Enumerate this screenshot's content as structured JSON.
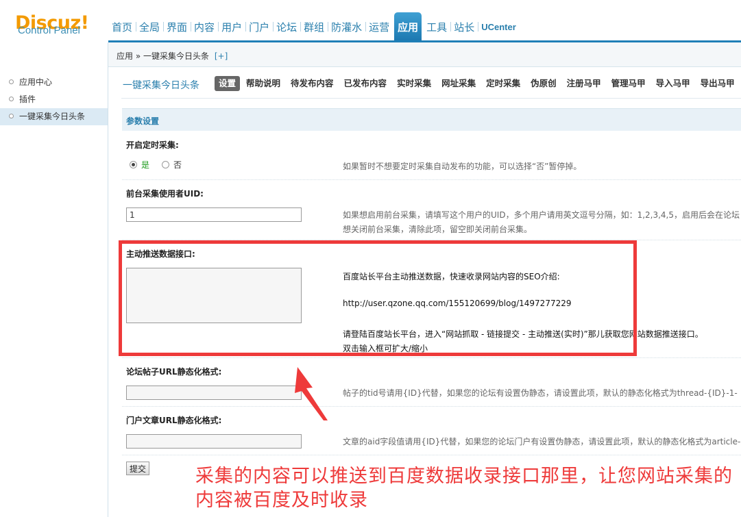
{
  "logo": {
    "brand": "Discuz!",
    "subtitle": "Control Panel"
  },
  "topnav": [
    {
      "label": "首页",
      "active": false
    },
    {
      "label": "全局",
      "active": false
    },
    {
      "label": "界面",
      "active": false
    },
    {
      "label": "内容",
      "active": false
    },
    {
      "label": "用户",
      "active": false
    },
    {
      "label": "门户",
      "active": false
    },
    {
      "label": "论坛",
      "active": false
    },
    {
      "label": "群组",
      "active": false
    },
    {
      "label": "防灌水",
      "active": false
    },
    {
      "label": "运营",
      "active": false
    },
    {
      "label": "应用",
      "active": true
    },
    {
      "label": "工具",
      "active": false
    },
    {
      "label": "站长",
      "active": false
    },
    {
      "label": "UCenter",
      "active": false
    }
  ],
  "sidebar": {
    "items": [
      {
        "label": "应用中心",
        "active": false
      },
      {
        "label": "插件",
        "active": false
      },
      {
        "label": "一键采集今日头条",
        "active": true
      }
    ]
  },
  "breadcrumb": {
    "root": "应用",
    "sep": "»",
    "current": "一键采集今日头条",
    "plus": "[+]"
  },
  "plugin": {
    "title": "一键采集今日头条",
    "tabs": [
      {
        "label": "设置",
        "active": true
      },
      {
        "label": "帮助说明",
        "active": false
      },
      {
        "label": "待发布内容",
        "active": false
      },
      {
        "label": "已发布内容",
        "active": false
      },
      {
        "label": "实时采集",
        "active": false
      },
      {
        "label": "网址采集",
        "active": false
      },
      {
        "label": "定时采集",
        "active": false
      },
      {
        "label": "伪原创",
        "active": false
      },
      {
        "label": "注册马甲",
        "active": false
      },
      {
        "label": "管理马甲",
        "active": false
      },
      {
        "label": "导入马甲",
        "active": false
      },
      {
        "label": "导出马甲",
        "active": false
      }
    ]
  },
  "section": {
    "title": "参数设置"
  },
  "form": {
    "timed": {
      "label": "开启定时采集:",
      "yes": "是",
      "no": "否",
      "selected": "是",
      "tip": "如果暂时不想要定时采集自动发布的功能，可以选择“否”暂停掉。"
    },
    "uid": {
      "label": "前台采集使用者UID:",
      "value": "1",
      "tip1": "如果想启用前台采集，请填写这个用户的UID，多个用户请用英文逗号分隔，如：1,2,3,4,5，启用后会在论坛",
      "tip2": "想关闭前台采集，清除此项，留空即关闭前台采集。"
    },
    "push": {
      "label": "主动推送数据接口:",
      "value": "",
      "line1": "百度站长平台主动推送数据，快速收录网站内容的SEO介绍:",
      "line2": "http://user.qzone.qq.com/155120699/blog/1497277229",
      "line3": "请登陆百度站长平台，进入“网站抓取 - 链接提交 - 主动推送(实时)”那儿获取您网站数据推送接口。",
      "line4": "双击输入框可扩大/缩小"
    },
    "forum_url": {
      "label": "论坛帖子URL静态化格式:",
      "value": "",
      "tip": "帖子的tid号请用{ID}代替，如果您的论坛有设置伪静态，请设置此项，默认的静态化格式为thread-{ID}-1-"
    },
    "portal_url": {
      "label": "门户文章URL静态化格式:",
      "value": "",
      "tip": "文章的aid字段值请用{ID}代替，如果您的论坛门户有设置伪静态，请设置此项，默认的静态化格式为article-"
    },
    "submit": "提交"
  },
  "annotation": {
    "text": "采集的内容可以推送到百度数据收录接口那里，让您网站采集的内容被百度及时收录",
    "color": "#ee3a3a"
  },
  "colors": {
    "accent": "#2a7fad",
    "nav_active": "#1f7fb7",
    "brand": "#f39a00"
  }
}
